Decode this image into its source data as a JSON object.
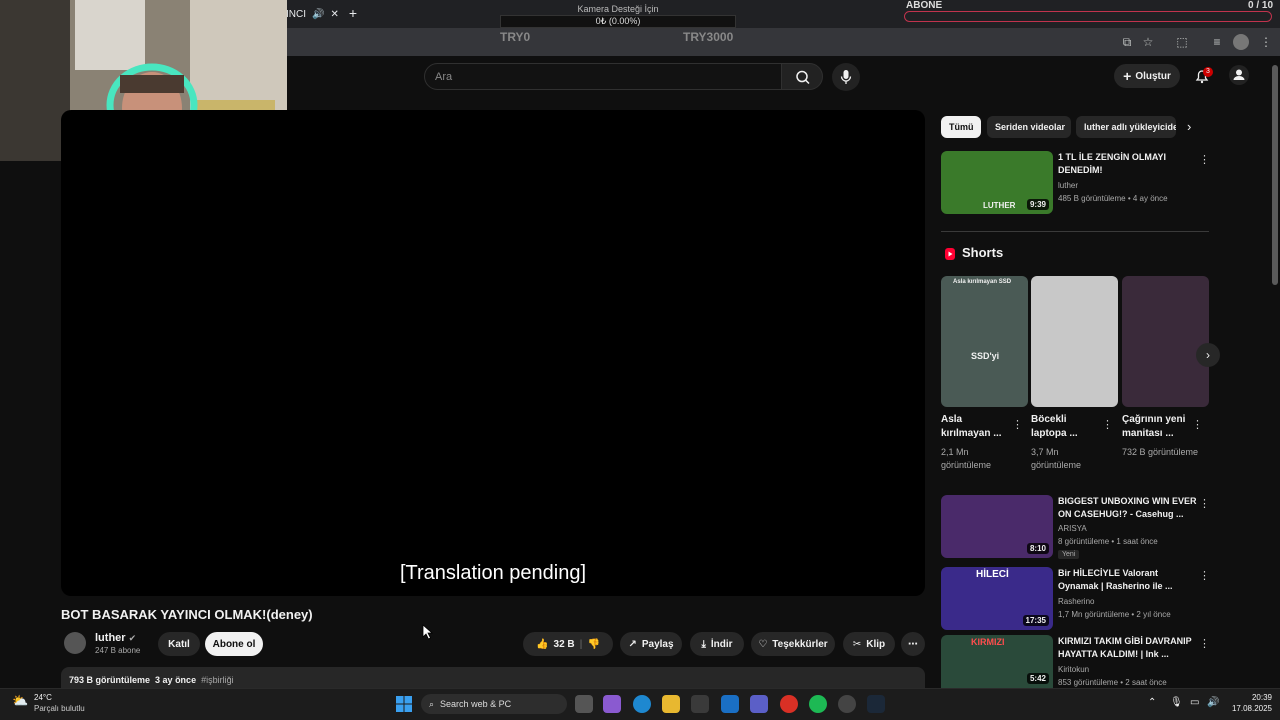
{
  "browser": {
    "active_tab_title": "INCI",
    "new_tab_label": "+"
  },
  "donation": {
    "title": "Kamera Desteği İçin",
    "value": "0₺ (0.00%)",
    "min_label": "TRY0",
    "max_label": "TRY3000"
  },
  "subscribe_goal": {
    "label": "ABONE",
    "count": "0 / 10",
    "progress": 0
  },
  "yt_header": {
    "search_placeholder": "Ara",
    "create_label": "Oluştur",
    "notification_count": "3"
  },
  "player": {
    "subtitle": "[Translation pending]"
  },
  "video": {
    "title": "BOT BASARAK YAYINCI OLMAK!(deney)",
    "channel_name": "luther",
    "subscribers": "247 B abone",
    "join_label": "Katıl",
    "subscribe_label": "Abone ol",
    "likes": "32 B",
    "share_label": "Paylaş",
    "download_label": "İndir",
    "thanks_label": "Teşekkürler",
    "clip_label": "Klip",
    "views": "793 B görüntüleme",
    "age": "3 ay önce",
    "hashtag": "#işbirliği"
  },
  "chips": [
    "Tümü",
    "Seriden videolar",
    "luther adlı yükleyiciden"
  ],
  "recommendations": [
    {
      "title": "1 TL İLE ZENGİN OLMAYI DENEDİM!",
      "channel": "luther",
      "meta": "485 B görüntüleme • 4 ay önce",
      "duration": "9:39",
      "thumb_text": "LUTHER",
      "color": "#3a7a2a"
    },
    {
      "title": "BIGGEST UNBOXING WIN EVER ON CASEHUG!? - Casehug ...",
      "channel": "ARISYA",
      "meta": "8 görüntüleme • 1 saat önce",
      "duration": "8:10",
      "badge": "Yeni",
      "color": "#4a2a6a"
    },
    {
      "title": "Bir HİLECİYLE Valorant Oynamak | Rasherino ile ...",
      "channel": "Rasherino",
      "meta": "1,7 Mn görüntüleme • 2 yıl önce",
      "duration": "17:35",
      "thumb_text": "HİLECİ",
      "color": "#3a2a8a"
    },
    {
      "title": "KIRMIZI TAKIM GİBİ DAVRANIP HAYATTA KALDIM! | Ink ...",
      "channel": "Kiritokun",
      "meta": "853 görüntüleme • 2 saat önce",
      "duration": "5:42",
      "thumb_text": "KIRMIZI",
      "color": "#2a4a3a"
    }
  ],
  "shorts": {
    "section_title": "Shorts",
    "items": [
      {
        "title": "Asla kırılmayan ...",
        "meta": "2,1 Mn görüntüleme",
        "overlay": "SSD'yi",
        "top_caption": "Asla kırılmayan SSD",
        "color": "#4a5a55"
      },
      {
        "title": "Böcekli laptopa ...",
        "meta": "3,7 Mn görüntüleme",
        "color": "#c8c8c8"
      },
      {
        "title": "Çağrının yeni manitası ...",
        "meta": "732 B görüntüleme",
        "color": "#3a2a3a"
      }
    ]
  },
  "taskbar": {
    "temperature": "24°C",
    "weather": "Parçalı bulutlu",
    "search_placeholder": "Search web & PC",
    "time": "20:39",
    "date": "17.08.2025"
  }
}
